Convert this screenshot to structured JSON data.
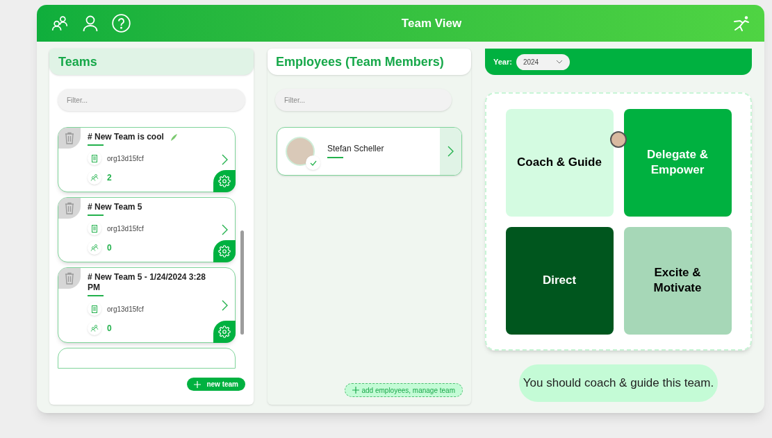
{
  "window": {
    "title": "Team View"
  },
  "teams": {
    "title": "Teams",
    "filter": {
      "placeholder": "Filter..."
    },
    "items": [
      {
        "name": "# New Team is cool",
        "leaf": true,
        "org": "org13d15fcf",
        "members": "2"
      },
      {
        "name": "# New Team 5",
        "leaf": false,
        "org": "org13d15fcf",
        "members": "0"
      },
      {
        "name": "# New Team 5 - 1/24/2024 3:28 PM",
        "leaf": false,
        "org": "org13d15fcf",
        "members": "0"
      }
    ],
    "new_button": "new team"
  },
  "employees": {
    "title": "Employees (Team Members)",
    "filter": {
      "placeholder": "Filter..."
    },
    "items": [
      {
        "name": "Stefan Scheller",
        "checked": true
      }
    ],
    "add_button": "add employees, manage team"
  },
  "matrix": {
    "year_label": "Year:",
    "year": "2024",
    "quadrants": [
      {
        "label": "Coach & Guide",
        "color": "#d4fbe1",
        "marker": true
      },
      {
        "label": "Delegate & Empower",
        "color": "#00b140",
        "marker": false
      },
      {
        "label": "Direct",
        "color": "#00561e",
        "marker": false
      },
      {
        "label": "Excite & Motivate",
        "color": "#a6d7b7",
        "marker": false
      }
    ],
    "advice": "You should coach & guide this team."
  }
}
